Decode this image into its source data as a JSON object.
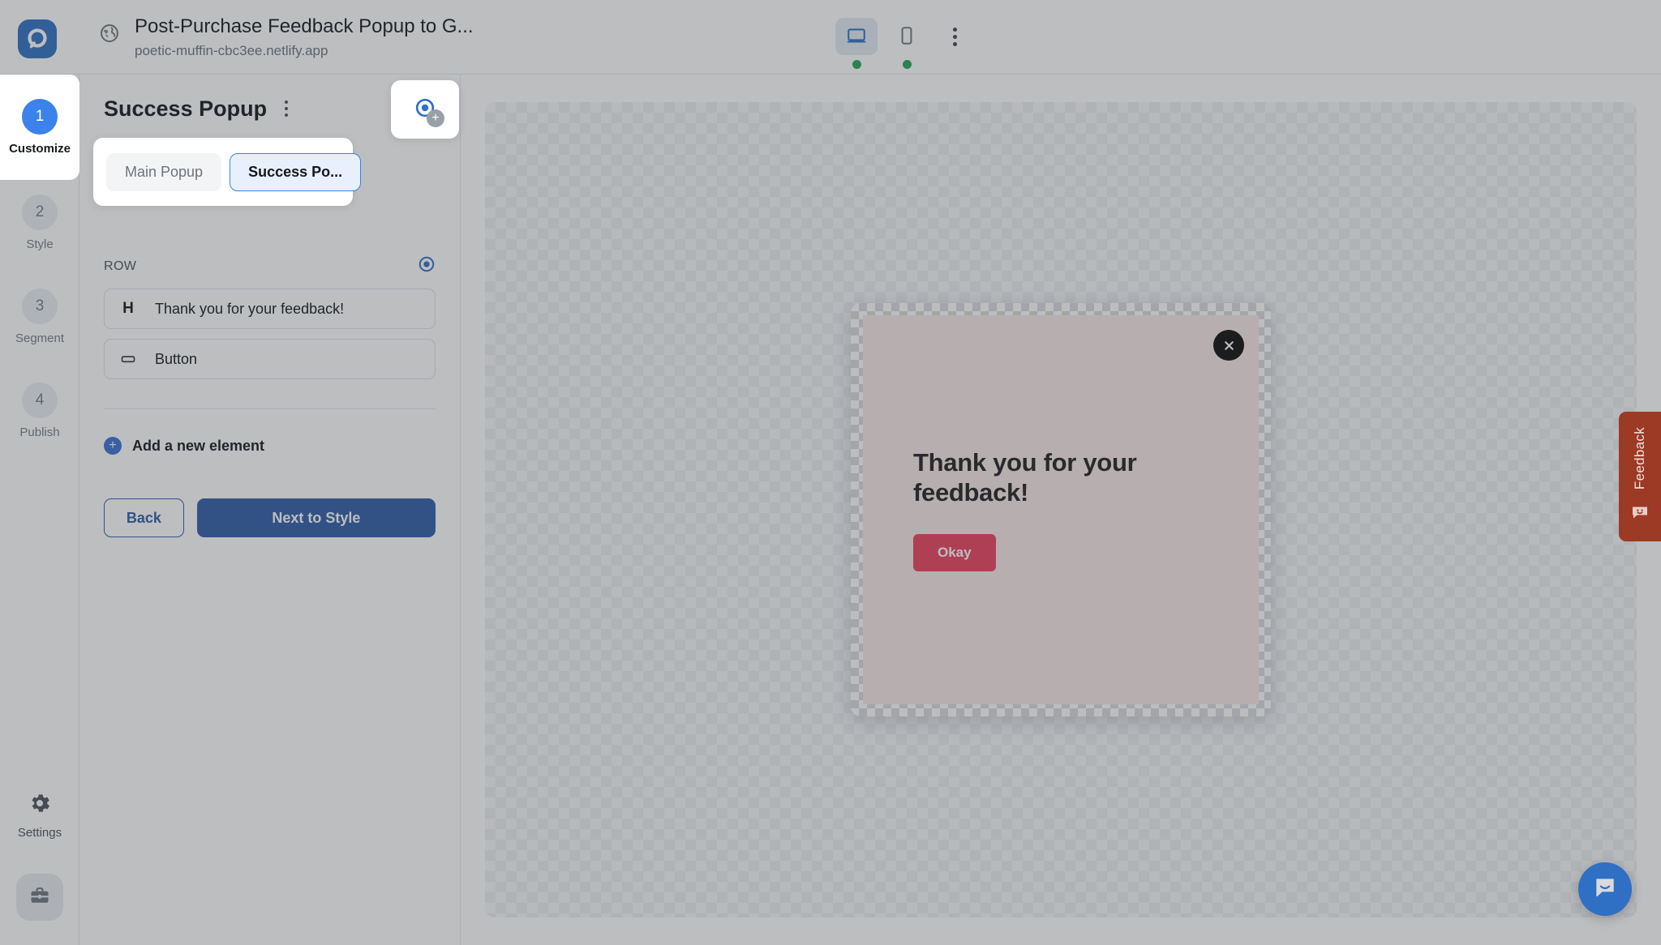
{
  "header": {
    "logo_icon": "popupsmart-logo-icon",
    "globe_icon": "globe-icon",
    "title": "Post-Purchase Feedback Popup to G...",
    "url": "poetic-muffin-cbc3ee.netlify.app",
    "devices": [
      {
        "name": "desktop",
        "icon": "desktop-icon",
        "active": true,
        "status_dot": "#23a455"
      },
      {
        "name": "mobile",
        "icon": "mobile-icon",
        "active": false,
        "status_dot": "#23a455"
      }
    ],
    "more_menu_icon": "kebab-menu-icon"
  },
  "rail": {
    "steps": [
      {
        "num": "1",
        "label": "Customize",
        "active": true
      },
      {
        "num": "2",
        "label": "Style",
        "active": false
      },
      {
        "num": "3",
        "label": "Segment",
        "active": false
      },
      {
        "num": "4",
        "label": "Publish",
        "active": false
      }
    ],
    "settings": {
      "icon": "gear-icon",
      "label": "Settings"
    },
    "workspace": {
      "icon": "briefcase-icon"
    }
  },
  "editor": {
    "title": "Success Popup",
    "title_menu_icon": "kebab-menu-icon",
    "variant_tabs": [
      {
        "label": "Main Popup",
        "active": false
      },
      {
        "label": "Success Po...",
        "active": true
      }
    ],
    "float_add": {
      "icon": "target-icon",
      "badge": "+"
    },
    "section": {
      "label": "ROW",
      "indicator_icon": "target-icon"
    },
    "elements": [
      {
        "icon": "H",
        "icon_name": "heading-icon",
        "name": "Thank you for your feedback!"
      },
      {
        "icon": "▭",
        "icon_name": "button-icon",
        "name": "Button"
      }
    ],
    "add_element": {
      "icon": "plus-icon",
      "label": "Add a new element"
    },
    "actions": {
      "back": "Back",
      "next": "Next to Style"
    }
  },
  "canvas": {
    "popup": {
      "close_icon": "close-icon",
      "heading": "Thank you for your feedback!",
      "cta_label": "Okay",
      "background_color": "#f8e8e6",
      "cta_color": "#ec3f5c"
    }
  },
  "widgets": {
    "feedback_tab": {
      "label": "Feedback",
      "icon": "feedback-smiley-icon",
      "color": "#9c3a25"
    },
    "chat_bubble": {
      "icon": "chat-icon",
      "color": "#2f6fc4"
    }
  }
}
